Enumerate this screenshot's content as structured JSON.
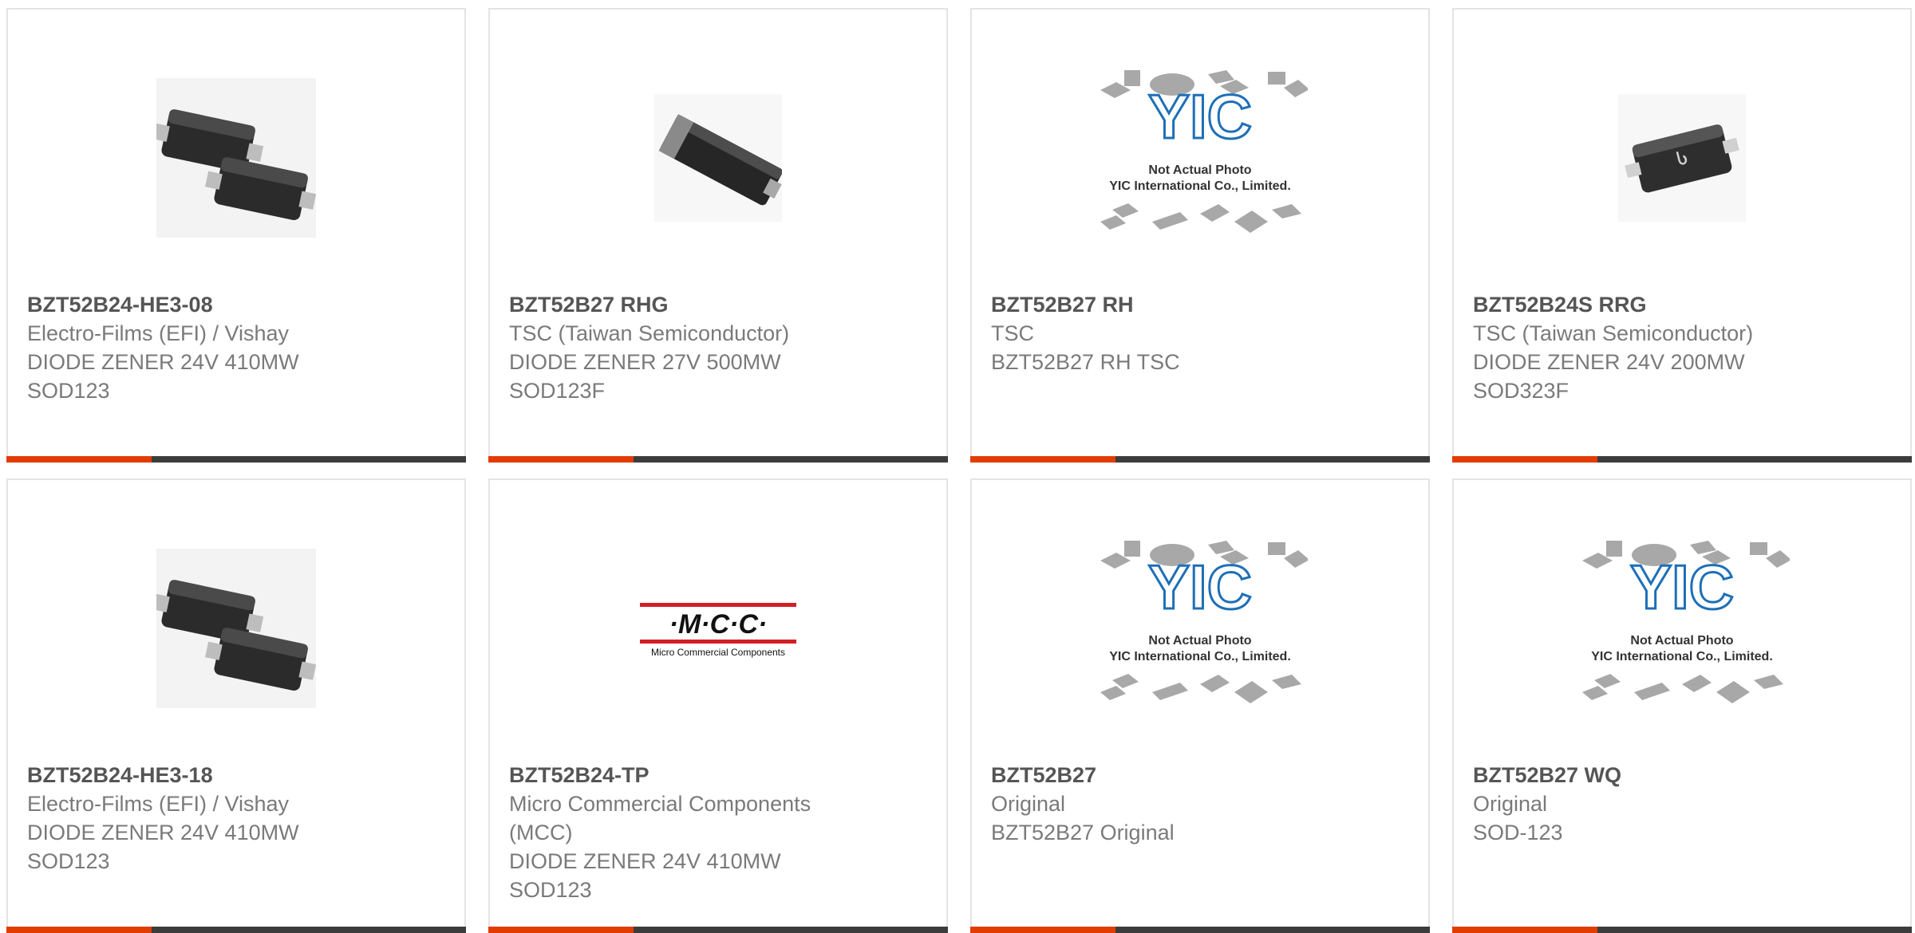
{
  "colors": {
    "accent": "#e23c00",
    "bar": "#3c3c3c",
    "border": "#e4e4e4",
    "title": "#555555",
    "text": "#7a7a7a",
    "yic_blue": "#1d6fb8",
    "mcc_red": "#d11f26"
  },
  "placeholder": {
    "line1": "Not Actual Photo",
    "line2": "YIC International Co., Limited.",
    "logo": "YIC"
  },
  "mcc_logo": {
    "mark": "·M·C·C·",
    "sub": "Micro Commercial Components"
  },
  "products": [
    {
      "part": "BZT52B24-HE3-08",
      "lines": [
        "Electro-Films (EFI) / Vishay",
        "DIODE ZENER 24V 410MW",
        "SOD123"
      ],
      "image": "sod123-pair-icon"
    },
    {
      "part": "BZT52B27 RHG",
      "lines": [
        "TSC (Taiwan Semiconductor)",
        "DIODE ZENER 27V 500MW",
        "SOD123F"
      ],
      "image": "sod123f-package-icon"
    },
    {
      "part": "BZT52B27 RH",
      "lines": [
        "TSC",
        "BZT52B27 RH TSC"
      ],
      "image": "not-actual-photo-placeholder"
    },
    {
      "part": "BZT52B24S RRG",
      "lines": [
        "TSC (Taiwan Semiconductor)",
        "DIODE ZENER 24V 200MW",
        "SOD323F"
      ],
      "image": "sod323f-package-icon"
    },
    {
      "part": "BZT52B24-HE3-18",
      "lines": [
        "Electro-Films (EFI) / Vishay",
        "DIODE ZENER 24V 410MW",
        "SOD123"
      ],
      "image": "sod123-pair-icon"
    },
    {
      "part": "BZT52B24-TP",
      "lines": [
        "Micro Commercial Components",
        "(MCC)",
        "DIODE ZENER 24V 410MW",
        "SOD123"
      ],
      "image": "mcc-logo"
    },
    {
      "part": "BZT52B27",
      "lines": [
        "Original",
        "BZT52B27 Original"
      ],
      "image": "not-actual-photo-placeholder"
    },
    {
      "part": "BZT52B27 WQ",
      "lines": [
        "Original",
        "SOD-123"
      ],
      "image": "not-actual-photo-placeholder"
    }
  ]
}
